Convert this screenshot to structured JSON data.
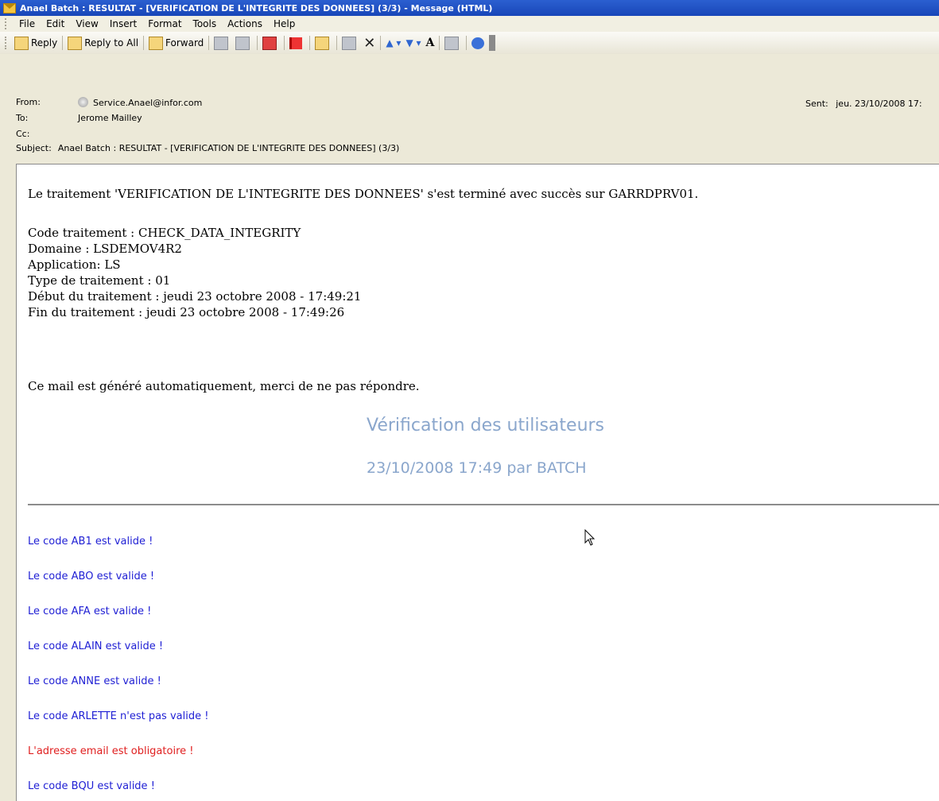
{
  "window": {
    "title": "Anael Batch : RESULTAT - [VERIFICATION DE L'INTEGRITE DES DONNEES] (3/3) - Message (HTML)"
  },
  "menu": [
    "File",
    "Edit",
    "View",
    "Insert",
    "Format",
    "Tools",
    "Actions",
    "Help"
  ],
  "toolbar": {
    "reply": "Reply",
    "reply_all": "Reply to All",
    "forward": "Forward"
  },
  "header": {
    "from_label": "From:",
    "from_value": "Service.Anael@infor.com",
    "to_label": "To:",
    "to_value": "Jerome Mailley",
    "cc_label": "Cc:",
    "cc_value": "",
    "subject_label": "Subject:",
    "subject_value": "Anael Batch : RESULTAT - [VERIFICATION DE L'INTEGRITE DES DONNEES] (3/3)",
    "sent_label": "Sent:",
    "sent_value": "jeu. 23/10/2008 17:"
  },
  "body": {
    "intro": "Le traitement 'VERIFICATION DE L'INTEGRITE DES DONNEES' s'est terminé avec succès sur GARRDPRV01.",
    "details": [
      "Code traitement : CHECK_DATA_INTEGRITY",
      "Domaine : LSDEMOV4R2",
      "Application: LS",
      "Type de traitement : 01",
      "Début du traitement : jeudi 23 octobre 2008 - 17:49:21",
      "Fin du traitement : jeudi 23 octobre 2008 - 17:49:26"
    ],
    "closing": "Ce mail est généré automatiquement, merci de ne pas répondre.",
    "report_title": "Vérification des utilisateurs",
    "report_subtitle": "23/10/2008 17:49 par BATCH",
    "results": [
      {
        "text": "Le code AB1 est valide !",
        "status": "ok"
      },
      {
        "text": "Le code ABO est valide !",
        "status": "ok"
      },
      {
        "text": "Le code AFA est valide !",
        "status": "ok"
      },
      {
        "text": "Le code ALAIN est valide !",
        "status": "ok"
      },
      {
        "text": "Le code ANNE est valide !",
        "status": "ok"
      },
      {
        "text": "Le code ARLETTE n'est pas valide !",
        "status": "ok"
      },
      {
        "text": "L'adresse email est obligatoire !",
        "status": "error"
      },
      {
        "text": "Le code BQU est valide !",
        "status": "ok"
      }
    ]
  },
  "colors": {
    "ok": "#1f1fd4",
    "error": "#e02020",
    "report_heading": "#8aa6cc"
  }
}
